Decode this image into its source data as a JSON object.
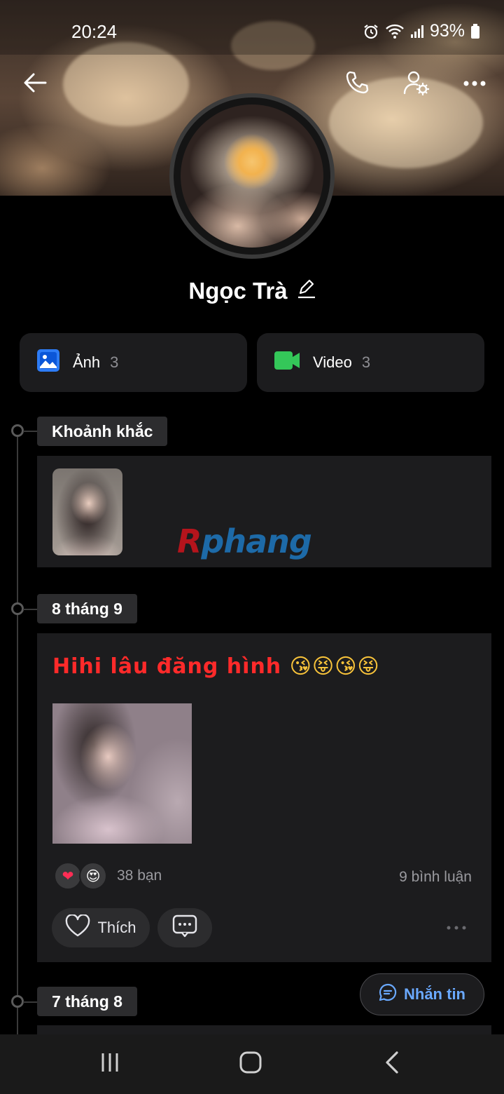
{
  "status_bar": {
    "time": "20:24",
    "battery": "93%",
    "icons": [
      "alarm-icon",
      "wifi-icon",
      "signal-icon",
      "battery-icon"
    ]
  },
  "header": {
    "icons": [
      "back-arrow-icon",
      "phone-icon",
      "user-settings-icon",
      "more-dots-icon"
    ]
  },
  "profile": {
    "name": "Ngọc Trà"
  },
  "media": [
    {
      "label": "Ảnh",
      "count": "3",
      "icon": "photo-icon",
      "color": "#2d7cf6"
    },
    {
      "label": "Video",
      "count": "3",
      "icon": "video-icon",
      "color": "#34c759"
    }
  ],
  "timeline": {
    "moments_label": "Khoảnh khắc",
    "watermark": {
      "part1": "R",
      "part2": "phang"
    },
    "post": {
      "date": "8 tháng 9",
      "text": "Hihi lâu đăng hình",
      "emojis": "😘😝😘😝",
      "reaction_icons": [
        "heart-reaction-icon",
        "heart-eyes-reaction-icon"
      ],
      "reaction_heart": "❤",
      "reaction_love": "😍",
      "reaction_count": "38 bạn",
      "comment_count": "9 bình luận",
      "like_label": "Thích"
    },
    "next_date": "7 tháng 8"
  },
  "message_button": {
    "label": "Nhắn tin"
  },
  "colors": {
    "background": "#000000",
    "card": "#1c1c1e",
    "accent_blue": "#6aa9ff",
    "post_text": "#ff2a2a"
  }
}
